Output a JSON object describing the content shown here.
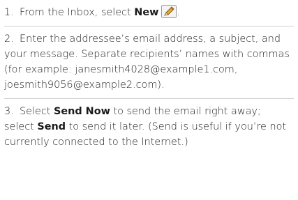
{
  "steps": [
    {
      "number": "1.",
      "parts": {
        "pre": "From the Inbox, select ",
        "bold": "New",
        "post": "."
      },
      "icon": "pencil-new-message-icon"
    },
    {
      "number": "2.",
      "text": "Enter the addressee’s email address, a subject, and your message. Separate recipients’ names with commas (for example: janesmith4028@example1.com, joesmith9056@example2.com)."
    },
    {
      "number": "3.",
      "parts": {
        "pre": "Select ",
        "bold1": "Send Now",
        "mid": " to send the email right away; select ",
        "bold2": "Send",
        "post": " to send it later. (Send is useful if you’re not currently connected to the Internet.)"
      }
    }
  ],
  "colors": {
    "divider": "#cfcfcf",
    "icon_border": "#9a9a9a",
    "icon_pencil": "#e8a62a"
  }
}
